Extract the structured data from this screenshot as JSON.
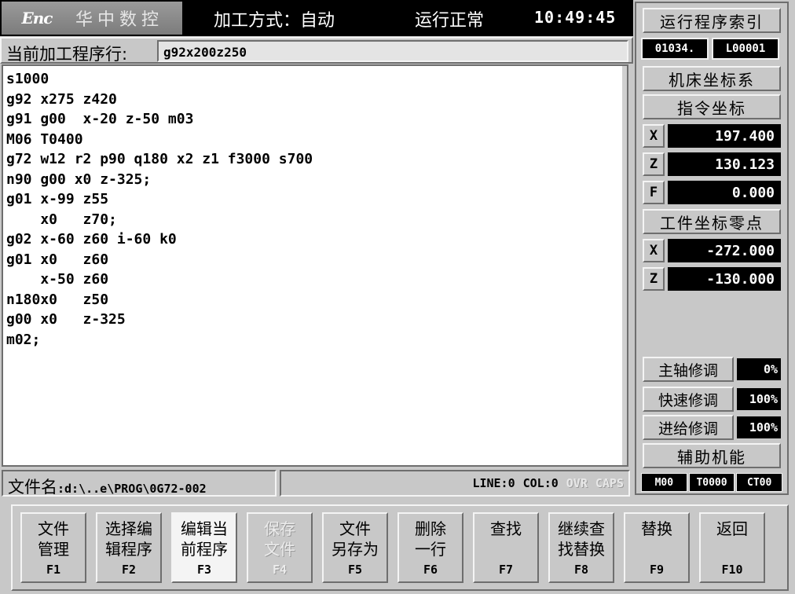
{
  "header": {
    "logo_mark": "Enc",
    "logo_text": "华中数控",
    "mode": "加工方式：自动",
    "status": "运行正常",
    "clock": "10:49:45"
  },
  "current_line": {
    "label": "当前加工程序行:",
    "value": "g92x200z250"
  },
  "editor": {
    "lines": [
      "s1000",
      "g92 x275 z420",
      "g91 g00  x-20 z-50 m03",
      "M06 T0400",
      "g72 w12 r2 p90 q180 x2 z1 f3000 s700",
      "n90 g00 x0 z-325;",
      "g01 x-99 z55",
      "    x0   z70;",
      "g02 x-60 z60 i-60 k0",
      "g01 x0   z60",
      "    x-50 z60",
      "n180x0   z50",
      "g00 x0   z-325",
      "m02;"
    ]
  },
  "file_bar": {
    "label": "文件名",
    "path": ":d:\\..e\\PROG\\0G72-002",
    "line": "LINE:0",
    "col": "COL:0",
    "ovr": "OVR",
    "caps": "CAPS"
  },
  "right_panel": {
    "run_index_btn": "运行程序索引",
    "index_left": "01034.",
    "index_right": "L00001",
    "machine_coord_btn": "机床坐标系",
    "command_coord_btn": "指令坐标",
    "cmd_axes": [
      {
        "axis": "X",
        "value": "197.400"
      },
      {
        "axis": "Z",
        "value": "130.123"
      },
      {
        "axis": "F",
        "value": "0.000"
      }
    ],
    "work_zero_btn": "工件坐标零点",
    "work_axes": [
      {
        "axis": "X",
        "value": "-272.000"
      },
      {
        "axis": "Z",
        "value": "-130.000"
      }
    ],
    "overrides": [
      {
        "label": "主轴修调",
        "value": "0%"
      },
      {
        "label": "快速修调",
        "value": "100%"
      },
      {
        "label": "进给修调",
        "value": "100%"
      }
    ],
    "aux_btn": "辅助机能",
    "mst": [
      "M00",
      "T0000",
      "CT00"
    ]
  },
  "fkeys": [
    {
      "label": "文件\n管理",
      "num": "F1"
    },
    {
      "label": "选择编\n辑程序",
      "num": "F2"
    },
    {
      "label": "编辑当\n前程序",
      "num": "F3"
    },
    {
      "label": "保存\n文件",
      "num": "F4"
    },
    {
      "label": "文件\n另存为",
      "num": "F5"
    },
    {
      "label": "删除\n一行",
      "num": "F6"
    },
    {
      "label": "查找",
      "num": "F7"
    },
    {
      "label": "继续查\n找替换",
      "num": "F8"
    },
    {
      "label": "替换",
      "num": "F9"
    },
    {
      "label": "返回",
      "num": "F10"
    }
  ]
}
